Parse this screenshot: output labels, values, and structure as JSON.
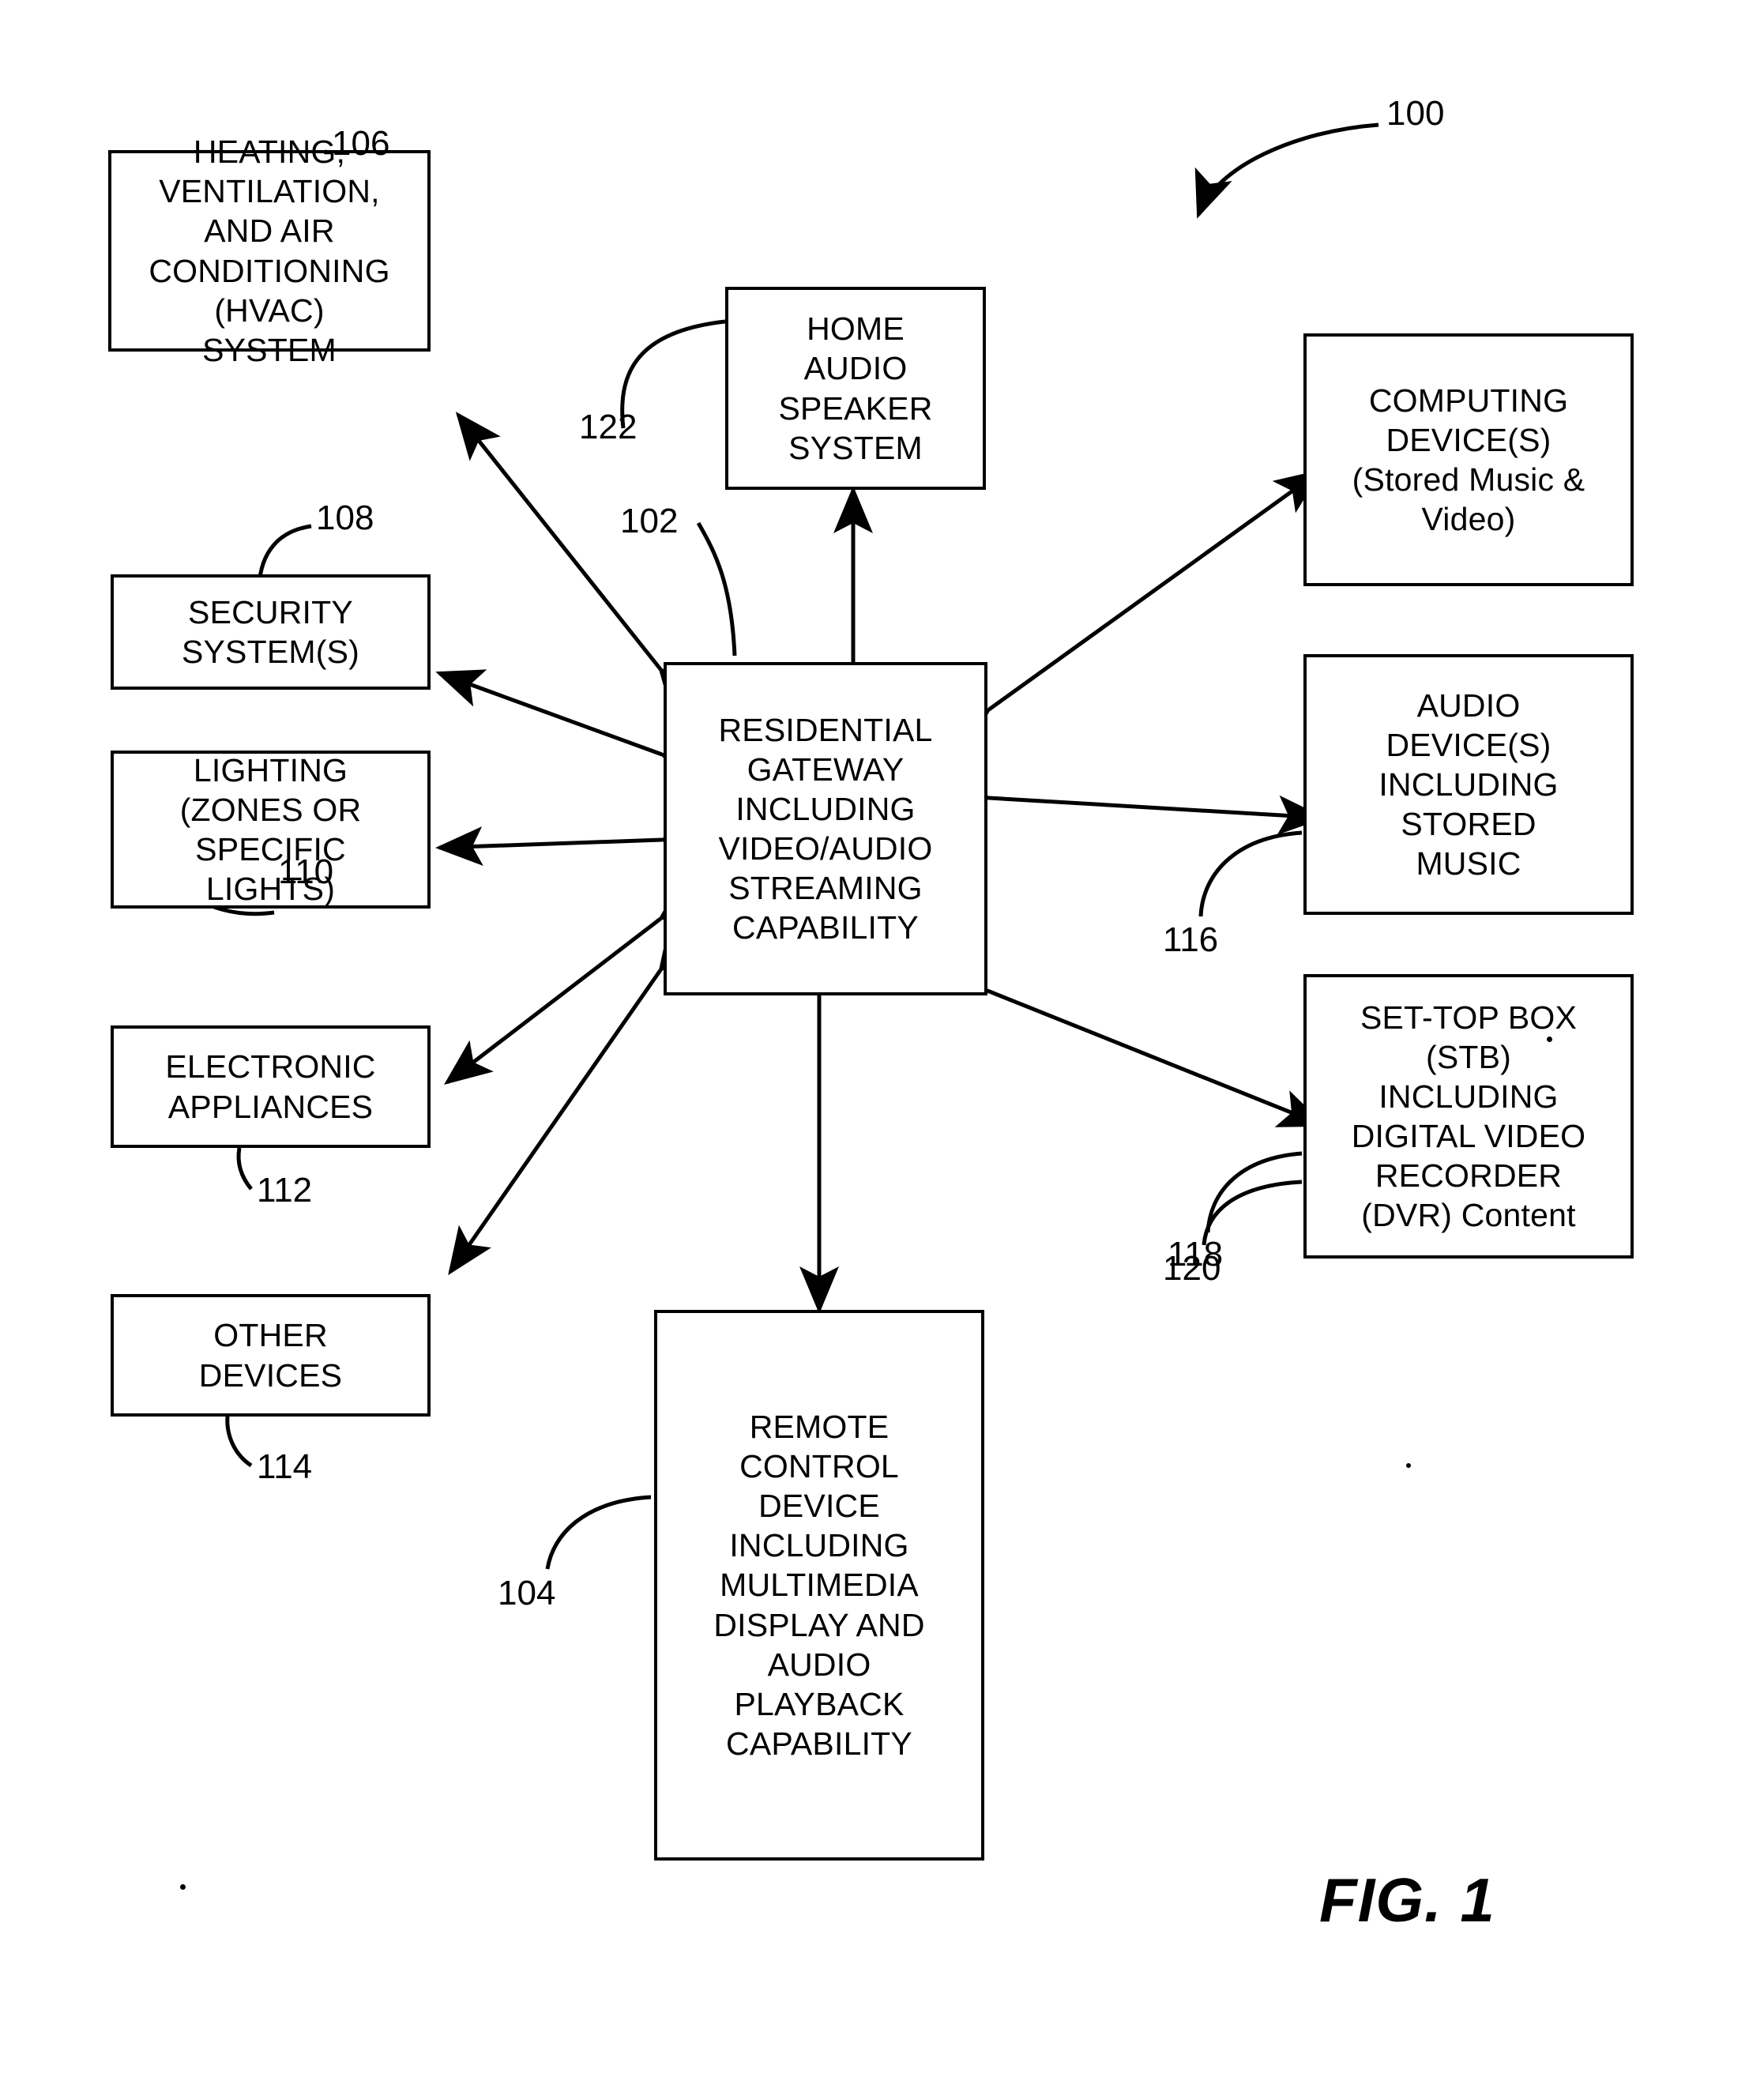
{
  "figure": {
    "caption": "FIG. 1",
    "system_ref": "100"
  },
  "nodes": [
    {
      "id": "hvac",
      "name": "hvac-system-box",
      "label": "HEATING,\nVENTILATION,\nAND AIR\nCONDITIONING\n(HVAC)\nSYSTEM",
      "ref": "106"
    },
    {
      "id": "security",
      "name": "security-system-box",
      "label": "SECURITY\nSYSTEM(S)",
      "ref": "108"
    },
    {
      "id": "lighting",
      "name": "lighting-box",
      "label": "LIGHTING\n(ZONES OR\nSPECIFIC\nLIGHTS)",
      "ref": "110"
    },
    {
      "id": "appliances",
      "name": "electronic-appliances-box",
      "label": "ELECTRONIC\nAPPLIANCES",
      "ref": "112"
    },
    {
      "id": "other_devices",
      "name": "other-devices-box",
      "label": "OTHER\nDEVICES",
      "ref": "114"
    },
    {
      "id": "speaker",
      "name": "home-audio-speaker-system-box",
      "label": "HOME\nAUDIO\nSPEAKER\nSYSTEM",
      "ref": "122"
    },
    {
      "id": "gateway",
      "name": "residential-gateway-box",
      "label": "RESIDENTIAL\nGATEWAY\nINCLUDING\nVIDEO/AUDIO\nSTREAMING\nCAPABILITY",
      "ref": "102"
    },
    {
      "id": "computing",
      "name": "computing-devices-box",
      "label": "COMPUTING\nDEVICE(S)\n(Stored Music &\nVideo)",
      "ref": "116"
    },
    {
      "id": "audio_devices",
      "name": "audio-devices-box",
      "label": "AUDIO\nDEVICE(S)\nINCLUDING\nSTORED\nMUSIC",
      "ref": "118"
    },
    {
      "id": "stb",
      "name": "set-top-box-box",
      "label": "SET-TOP BOX\n(STB)\nINCLUDING\nDIGITAL VIDEO\nRECORDER\n(DVR) Content",
      "ref": "120"
    },
    {
      "id": "remote",
      "name": "remote-control-device-box",
      "label": "REMOTE\nCONTROL\nDEVICE\nINCLUDING\nMULTIMEDIA\nDISPLAY AND\nAUDIO\nPLAYBACK\nCAPABILITY",
      "ref": "104"
    }
  ],
  "reference_numerals": {
    "system": "100",
    "gateway": "102",
    "remote": "104",
    "hvac": "106",
    "security": "108",
    "lighting": "110",
    "appliances": "112",
    "other_devices": "114",
    "computing": "116",
    "audio_devices": "118",
    "stb": "120",
    "speaker": "122"
  },
  "style": {
    "line_color": "#000000",
    "background": "#ffffff"
  }
}
